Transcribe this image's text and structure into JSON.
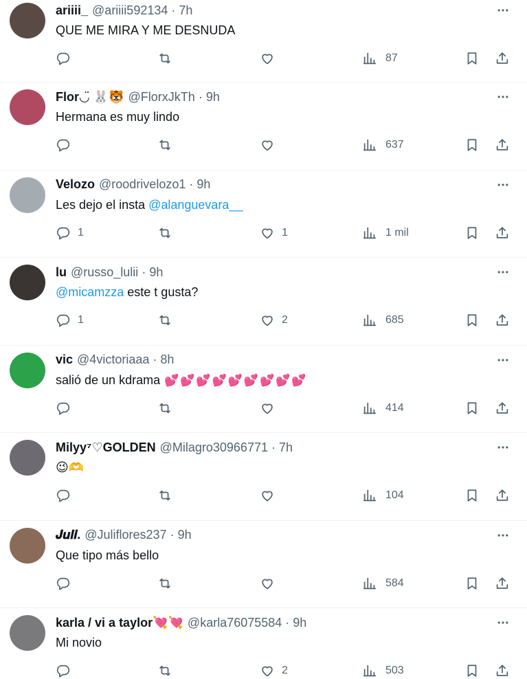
{
  "tweets": [
    {
      "name": "ariiii_",
      "handle": "@ariiii592134",
      "time": "7h",
      "text": "QUE ME MIRA Y ME DESNUDA",
      "replies": "",
      "likes": "",
      "views": "87",
      "avatar_color": "#5a4a45"
    },
    {
      "name": "Flor",
      "name_emoji": "◡̈ 🐰🐯",
      "handle": "@FlorxJkTh",
      "time": "9h",
      "text": "Hermana es muy lindo",
      "replies": "",
      "likes": "",
      "views": "637",
      "avatar_color": "#b04a62"
    },
    {
      "name": "Velozo",
      "handle": "@roodrivelozo1",
      "time": "9h",
      "text_prefix": "Les dejo el insta ",
      "mention": "@alanguevara__",
      "replies": "1",
      "likes": "1",
      "views": "1 mil",
      "avatar_color": "#a4acb2"
    },
    {
      "name": "lu",
      "handle": "@russo_lulii",
      "time": "9h",
      "mention": "@micamzza",
      "text_suffix": " este t gusta?",
      "replies": "1",
      "likes": "2",
      "views": "685",
      "avatar_color": "#3a3433"
    },
    {
      "name": "vic",
      "handle": "@4victoriaaa",
      "time": "8h",
      "text": "salió de un kdrama",
      "text_emoji": "💕💕💕💕💕💕💕💕💕",
      "replies": "",
      "likes": "",
      "views": "414",
      "avatar_color": "#2ca24a"
    },
    {
      "name": "Milyy⁷♡GOLDEN",
      "handle": "@Milagro30966771",
      "time": "7h",
      "text": "😉🫶",
      "replies": "",
      "likes": "",
      "views": "104",
      "avatar_color": "#6e6a72"
    },
    {
      "name": "𝑱𝒖𝒍𝒊.",
      "handle": "@Juliflores237",
      "time": "9h",
      "text": "Que tipo más bello",
      "replies": "",
      "likes": "",
      "views": "584",
      "avatar_color": "#8a6a58"
    },
    {
      "name": "karla / vi a taylor",
      "name_emoji": "💘💘",
      "handle": "@karla76075584",
      "time": "9h",
      "text": "Mi novio",
      "replies": "",
      "likes": "2",
      "views": "503",
      "avatar_color": "#7a7a7c"
    }
  ],
  "separator": "·",
  "icons": {
    "reply": "reply-icon",
    "retweet": "retweet-icon",
    "like": "heart-icon",
    "views": "views-icon",
    "bookmark": "bookmark-icon",
    "share": "share-icon",
    "more": "more-icon"
  }
}
